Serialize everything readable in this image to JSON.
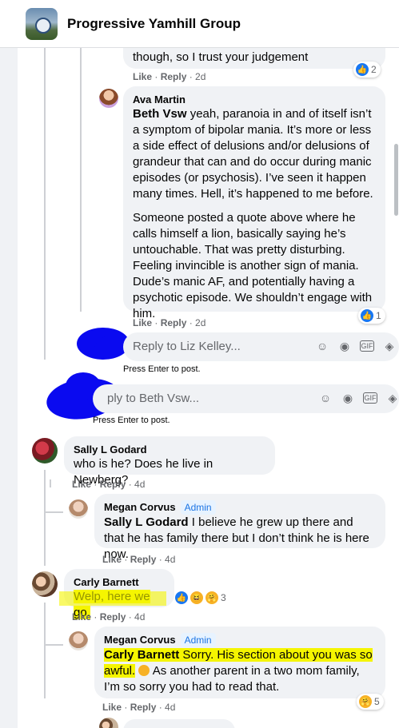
{
  "header": {
    "group_name": "Progressive Yamhill Group",
    "group_avatar_icon": "group-photo-icon"
  },
  "reply_prev": {
    "text_tail": "though, so I trust your judgement",
    "like": "Like",
    "reply": "Reply",
    "time": "2d",
    "reaction_count": "2"
  },
  "ava": {
    "author": "Ava Martin",
    "mention": "Beth Vsw",
    "p1": "yeah, paranoia in and of itself isn’t a symptom of bipolar mania. It’s more or less a side effect of delusions and/or delusions of grandeur that can and do occur during manic episodes (or psychosis). I’ve seen it happen many times. Hell, it’s happened to me before.",
    "p2": "Someone posted a quote above where he calls himself a lion, basically saying he’s untouchable. That was pretty disturbing. Feeling invincible is another sign of mania. Dude’s manic AF, and potentially having a psychotic episode. We shouldn’t engage with him.",
    "like": "Like",
    "reply": "Reply",
    "time": "2d",
    "reaction_count": "1"
  },
  "reply_box_1": {
    "placeholder": "Reply to Liz Kelley...",
    "hint": "Press Enter to post."
  },
  "reply_box_2": {
    "placeholder": "ply to Beth Vsw...",
    "hint": "Press Enter to post."
  },
  "sally": {
    "author": "Sally L Godard",
    "text": "who is he? Does he live in Newberg?",
    "like": "Like",
    "reply": "Reply",
    "time": "4d"
  },
  "megan1": {
    "author": "Megan Corvus",
    "badge": "Admin",
    "mention": "Sally L Godard",
    "text": "I believe he grew up there and that he has family there but I don’t think he is here now.",
    "like": "Like",
    "reply": "Reply",
    "time": "4d"
  },
  "carly": {
    "author": "Carly Barnett",
    "text": "Welp, here we go.",
    "like": "Like",
    "reply": "Reply",
    "time": "4d",
    "reaction_count": "3"
  },
  "megan2": {
    "author": "Megan Corvus",
    "badge": "Admin",
    "mention": "Carly Barnett",
    "text_a": "Sorry. His section about you was so awful.",
    "text_b": "As another parent in a two mom family, I’m so sorry you had to read that.",
    "like": "Like",
    "reply": "Reply",
    "time": "4d",
    "reaction_count": "5"
  },
  "colors": {
    "accent": "#1877f2",
    "highlight": "#f5f500",
    "scribble": "#0a0af0",
    "admin": "#1b74e4"
  }
}
